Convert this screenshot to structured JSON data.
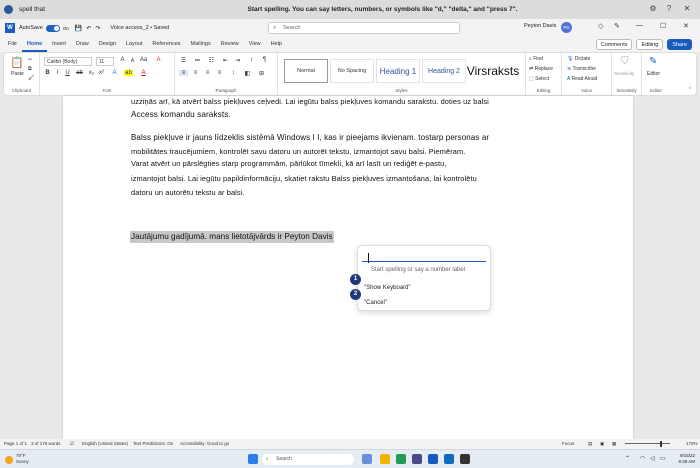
{
  "voice_bar": {
    "app_name": "spell that",
    "status": "Start spelling. You can say letters, numbers, or symbols like \"d,\" \"delta,\" and \"press 7\"."
  },
  "title_bar": {
    "autosave_label": "AutoSave",
    "autosave_state": "On",
    "doc_name": "Voice access_2 • Saved",
    "search_placeholder": "Search",
    "user_name": "Peyton Davis",
    "user_initials": "PD"
  },
  "tabs": [
    "File",
    "Home",
    "Insert",
    "Draw",
    "Design",
    "Layout",
    "References",
    "Mailings",
    "Review",
    "View",
    "Help"
  ],
  "ribbon_buttons": {
    "comments": "Comments",
    "editing": "Editing",
    "share": "Share"
  },
  "ribbon": {
    "clipboard": {
      "paste": "Paste",
      "label": "Clipboard"
    },
    "font": {
      "name": "Calibri (Body)",
      "size": "11",
      "label": "Font"
    },
    "paragraph": {
      "label": "Paragraph"
    },
    "styles": {
      "items": [
        "Normal",
        "No Spacing",
        "Heading 1",
        "Heading 2",
        "Virsraksts"
      ],
      "label": "Styles"
    },
    "editing": {
      "find": "Find",
      "replace": "Replace",
      "select": "Select",
      "label": "Editing"
    },
    "voice": {
      "dictate": "Dictate",
      "transcribe": "Transcribe",
      "read_aloud": "Read Aloud",
      "label": "Voice"
    },
    "sensitivity": {
      "btn": "Sensitivity",
      "label": "Sensitivity"
    },
    "editor": {
      "btn": "Editor",
      "label": "Editor"
    }
  },
  "document": {
    "p1": "uzziņās arī, kā atvērt balss piekļuves ceļvedi. Lai iegūtu balss piekļuves komandu sarakstu. doties uz balsi",
    "p1b": "Access komandu saraksts.",
    "p2a": "Balss piekļuve ir jauns līdzeklis sistēmā Windows I I, kas ir pieejams ikvienam. tostarp personas ar",
    "p2b": "mobilitātes traucējumiem, kontrolēt savu datoru un autorēt tekstu, izmantojot savu balsi. Piemēram.",
    "p2c": "Varat atvērt un pārslēgties starp programmām, pārlūkot tīmekli, kā arī lasīt un rediģēt e-pastu,",
    "p2d": "izmantojot balsi. Lai iegūtu papildinformāciju, skatiet rakstu Balss piekļuves izmantošana, lai kontrolētu",
    "p2e": "datoru un autorētu tekstu ar balsi.",
    "selected": "Jautājumu gadījumā. mans lietotājvārds ir Peyton Davis"
  },
  "spell_popup": {
    "placeholder": "Start spelling or say a number label",
    "items": [
      {
        "num": "1",
        "label": "\"Show Keyboard\""
      },
      {
        "num": "2",
        "label": "\"Cancel\""
      }
    ]
  },
  "status_bar": {
    "page": "Page 1 of 1",
    "words": "3 of 176 words",
    "language": "English (United States)",
    "predictions": "Text Predictions: On",
    "accessibility": "Accessibility: Good to go",
    "focus": "Focus",
    "zoom": "170%"
  },
  "taskbar": {
    "temp": "78°F",
    "weather": "Sunny",
    "search": "Search",
    "date": "9/15/22",
    "time": "9:28 AM"
  },
  "colors": {
    "accent": "#185abd",
    "selection": "#c8c8c8",
    "badge": "#1f3a7a"
  }
}
